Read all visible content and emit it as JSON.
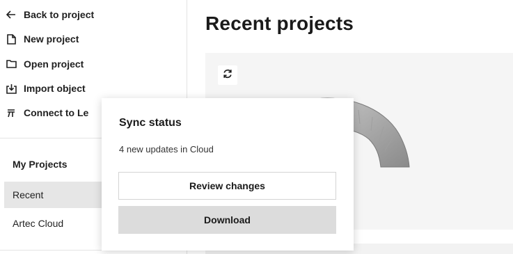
{
  "sidebar": {
    "menu": [
      {
        "label": "Back to project",
        "icon": "arrow-left-icon"
      },
      {
        "label": "New project",
        "icon": "new-file-icon"
      },
      {
        "label": "Open project",
        "icon": "folder-icon"
      },
      {
        "label": "Import object",
        "icon": "import-icon"
      },
      {
        "label": "Connect to Le",
        "icon": "leo-icon"
      }
    ],
    "section_title": "My Projects",
    "nav": [
      {
        "label": "Recent",
        "active": true
      },
      {
        "label": "Artec Cloud",
        "active": false
      }
    ]
  },
  "main": {
    "title": "Recent projects",
    "card": {
      "sync_icon": "sync-icon"
    }
  },
  "popover": {
    "title": "Sync status",
    "subtitle": "4 new updates in Cloud",
    "review_label": "Review changes",
    "download_label": "Download"
  },
  "colors": {
    "active_nav_bg": "#e6e6e6",
    "card_bg": "#f5f5f5",
    "download_bg": "#dcdcdc"
  }
}
